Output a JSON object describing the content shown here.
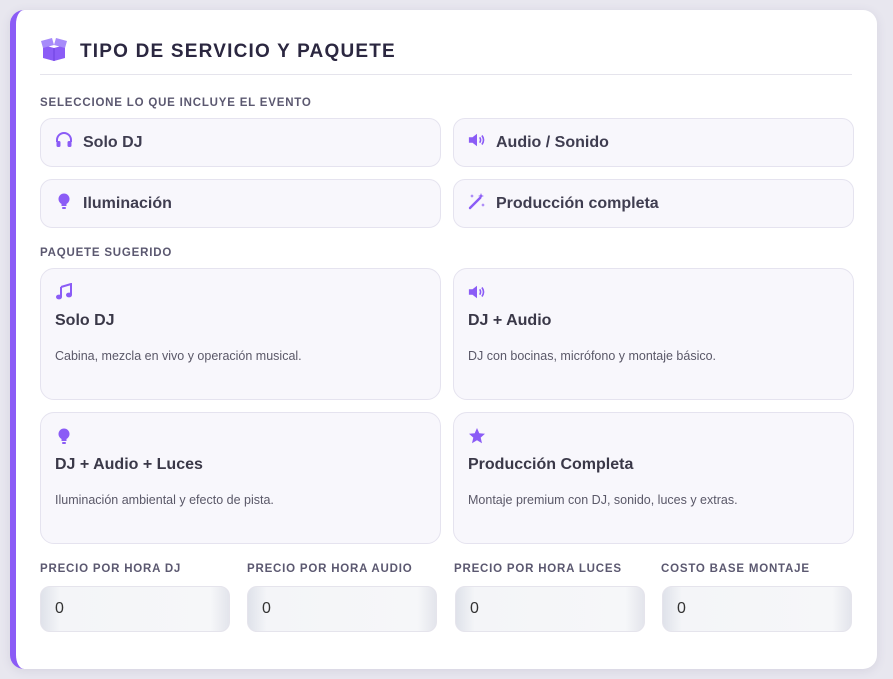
{
  "section": {
    "title": "TIPO DE SERVICIO Y PAQUETE",
    "icon": "box-open-icon",
    "accent_color": "#8b5cf6"
  },
  "includes": {
    "label": "SELECCIONE LO QUE INCLUYE EL EVENTO",
    "options": [
      {
        "label": "Solo DJ",
        "icon": "headphones-icon"
      },
      {
        "label": "Audio / Sonido",
        "icon": "volume-icon"
      },
      {
        "label": "Iluminación",
        "icon": "lightbulb-icon"
      },
      {
        "label": "Producción completa",
        "icon": "magic-wand-icon"
      }
    ]
  },
  "packages": {
    "label": "PAQUETE SUGERIDO",
    "items": [
      {
        "name": "Solo DJ",
        "description": "Cabina, mezcla en vivo y operación musical.",
        "icon": "music-note-icon"
      },
      {
        "name": "DJ + Audio",
        "description": "DJ con bocinas, micrófono y montaje básico.",
        "icon": "volume-icon"
      },
      {
        "name": "DJ + Audio + Luces",
        "description": "Iluminación ambiental y efecto de pista.",
        "icon": "lightbulb-icon"
      },
      {
        "name": "Producción Completa",
        "description": "Montaje premium con DJ, sonido, luces y extras.",
        "icon": "star-icon"
      }
    ]
  },
  "pricing": {
    "fields": [
      {
        "label": "PRECIO POR HORA DJ",
        "value": "0"
      },
      {
        "label": "PRECIO POR HORA AUDIO",
        "value": "0"
      },
      {
        "label": "PRECIO POR HORA LUCES",
        "value": "0"
      },
      {
        "label": "COSTO BASE MONTAJE",
        "value": "0"
      }
    ]
  }
}
